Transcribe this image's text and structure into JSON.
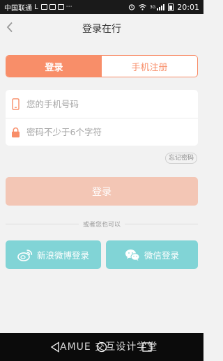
{
  "status_bar": {
    "carrier": "中国联通",
    "carrier_suffix": "L",
    "time": "20:01",
    "network": "3G"
  },
  "header": {
    "title": "登录在行",
    "back_icon": "chevron-left-icon"
  },
  "tabs": {
    "login": "登录",
    "register": "手机注册"
  },
  "form": {
    "phone_placeholder": "您的手机号码",
    "password_placeholder": "密码不少于6个字符",
    "forgot": "忘记密码",
    "submit": "登录"
  },
  "divider": {
    "text": "或者您也可以"
  },
  "social": {
    "weibo": "新浪微博登录",
    "wechat": "微信登录"
  },
  "watermark": "AMUE 交互设计学堂",
  "colors": {
    "accent": "#f88e69",
    "accent_light": "#f3c6b5",
    "teal": "#81d4d6"
  }
}
